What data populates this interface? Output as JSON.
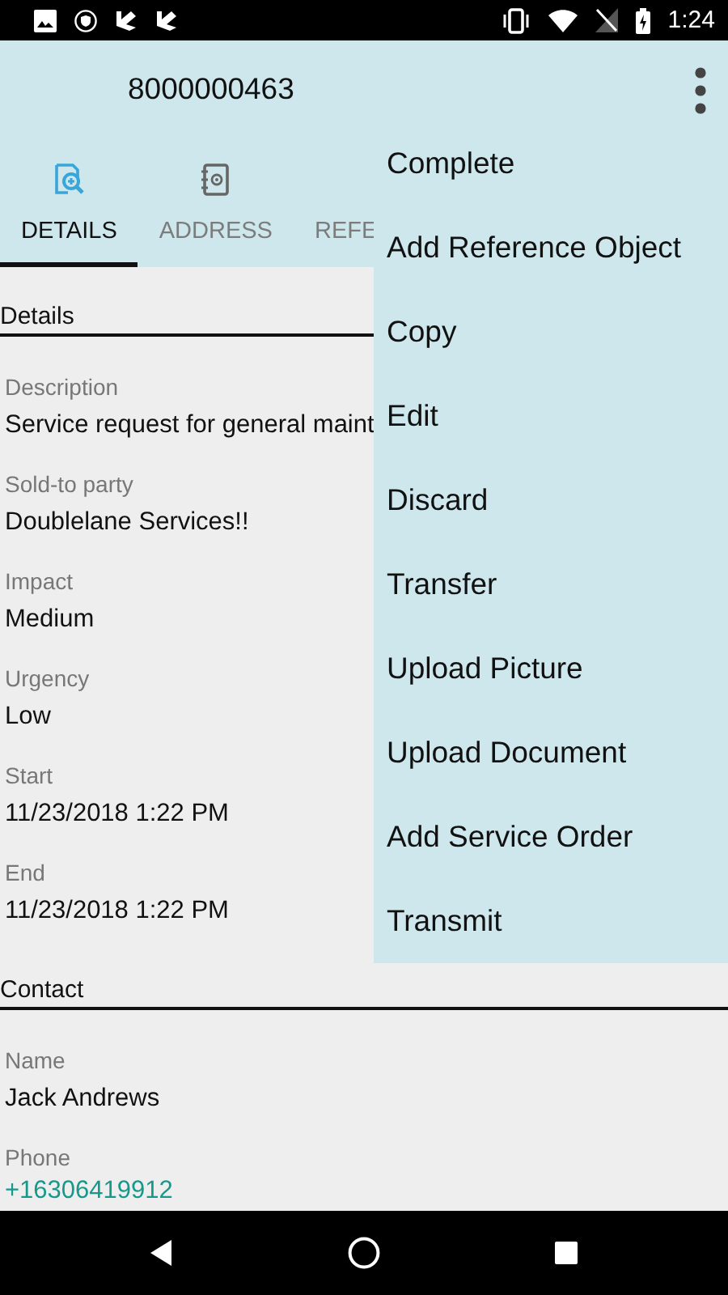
{
  "status_bar": {
    "time": "1:24"
  },
  "toolbar": {
    "title": "8000000463"
  },
  "tabs": [
    {
      "label": "DETAILS",
      "kind": "details",
      "selected": true
    },
    {
      "label": "ADDRESS",
      "kind": "address",
      "selected": false
    },
    {
      "label": "REFE",
      "kind": "reference",
      "selected": false
    }
  ],
  "sections": [
    {
      "title": "Details",
      "fields": [
        {
          "label": "Description",
          "value": "Service request for general maint",
          "kind": "text"
        },
        {
          "label": "Sold-to party",
          "value": "Doublelane Services!!",
          "kind": "text"
        },
        {
          "label": "Impact",
          "value": "Medium",
          "kind": "text"
        },
        {
          "label": "Urgency",
          "value": "Low",
          "kind": "text"
        },
        {
          "label": "Start",
          "value": "11/23/2018 1:22 PM",
          "kind": "text"
        },
        {
          "label": "End",
          "value": "11/23/2018 1:22 PM",
          "kind": "text"
        }
      ]
    },
    {
      "title": "Contact",
      "fields": [
        {
          "label": "Name",
          "value": "Jack Andrews",
          "kind": "text"
        },
        {
          "label": "Phone",
          "value": "+16306419912",
          "kind": "link"
        }
      ]
    }
  ],
  "menu": {
    "items": [
      "Complete",
      "Add Reference Object",
      "Copy",
      "Edit",
      "Discard",
      "Transfer",
      "Upload Picture",
      "Upload Document",
      "Add Service Order",
      "Transmit"
    ]
  }
}
